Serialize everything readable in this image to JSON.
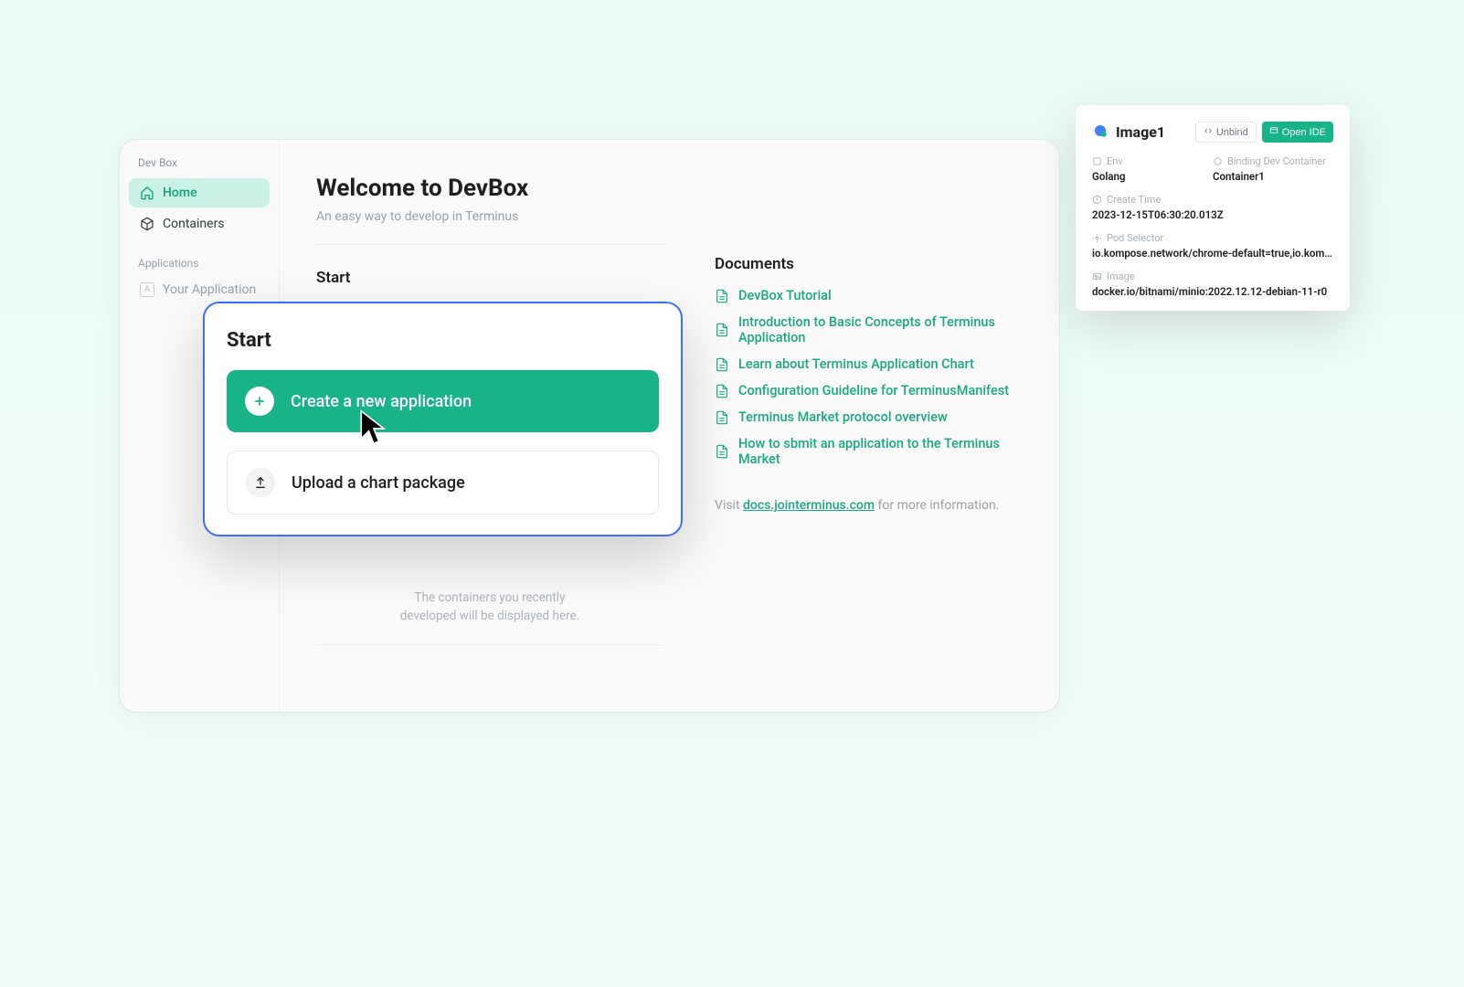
{
  "sidebar": {
    "title": "Dev Box",
    "items": [
      {
        "label": "Home"
      },
      {
        "label": "Containers"
      }
    ],
    "applications_label": "Applications",
    "your_application": "Your Application"
  },
  "header": {
    "title": "Welcome to DevBox",
    "subtitle": "An easy way to develop in Terminus"
  },
  "start": {
    "title": "Start",
    "create_label": "Create a new application",
    "upload_label": "Upload a chart package"
  },
  "recent": {
    "hint_line1": "The containers you recently",
    "hint_line2": "developed will be displayed here."
  },
  "documents": {
    "title": "Documents",
    "items": [
      "DevBox Tutorial",
      "Introduction to Basic Concepts of Terminus Application",
      "Learn about Terminus Application Chart",
      "Configuration Guideline for TerminusManifest",
      "Terminus Market protocol overview",
      "How to sbmit an application to the Terminus Market"
    ],
    "more_prefix": "Visit ",
    "more_link": "docs.jointerminus.com",
    "more_suffix": " for more information."
  },
  "detail": {
    "title": "Image1",
    "unbind": "Unbind",
    "open_ide": "Open IDE",
    "env_label": "Env",
    "env_value": "Golang",
    "dev_container_label": "Binding Dev Container",
    "dev_container_value": "Container1",
    "create_time_label": "Create Time",
    "create_time_value": "2023-12-15T06:30:20.013Z",
    "pod_label": "Pod Selector",
    "pod_value": "io.kompose.network/chrome-default=true,io.kompose.service=ter…",
    "image_label": "Image",
    "image_value": "docker.io/bitnami/minio:2022.12.12-debian-11-r0"
  }
}
